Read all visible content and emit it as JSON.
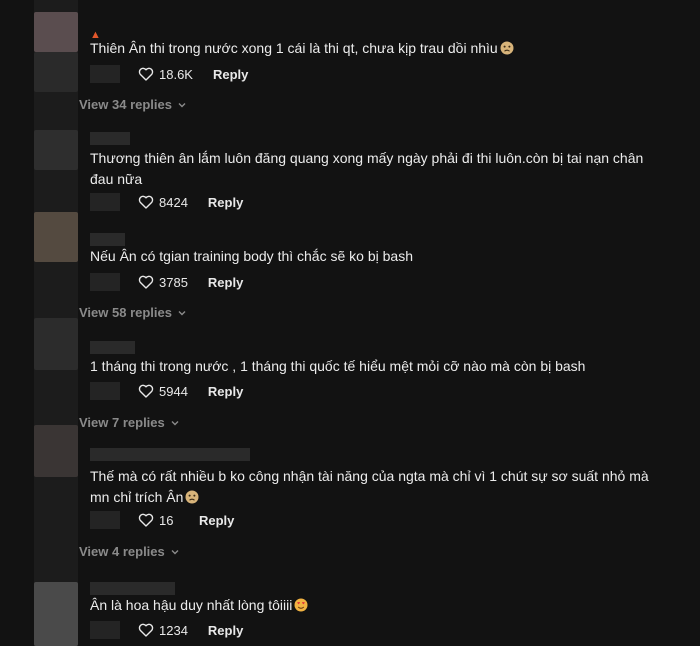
{
  "comments": [
    {
      "text": "Thiên Ân thi trong nước xong 1 cái là thi qt, chưa kịp trau dồi nhìu",
      "emoji_icon": "sad-face-icon",
      "likes": "18.6K",
      "reply_label": "Reply",
      "view_replies": "View 34 replies"
    },
    {
      "text": "Thương thiên ân lắm luôn đăng quang xong mấy ngày phải đi thi luôn.còn bị tai nạn chân đau nữa",
      "likes": "8424",
      "reply_label": "Reply"
    },
    {
      "text": "Nếu Ân có tgian training body thì chắc sẽ ko bị bash",
      "likes": "3785",
      "reply_label": "Reply",
      "view_replies": "View 58 replies"
    },
    {
      "text": "1 tháng thi trong nước , 1 tháng thi quốc tế hiểu mệt mỏi cỡ nào mà còn bị bash",
      "likes": "5944",
      "reply_label": "Reply",
      "view_replies": "View 7 replies"
    },
    {
      "text": "Thế mà có rất nhiều b ko công nhận tài năng của ngta mà chỉ vì 1 chút sự sơ suất nhỏ mà mn chỉ trích Ân",
      "emoji_icon": "sad-face-icon",
      "likes": "16",
      "reply_label": "Reply",
      "view_replies": "View 4 replies"
    },
    {
      "text": "Ân là hoa hậu duy nhất lòng tôiiii",
      "emoji_icon": "heart-eyes-face-icon",
      "likes": "1234",
      "reply_label": "Reply"
    }
  ],
  "colors": {
    "background": "#121212",
    "text": "#ececec",
    "muted": "#8a8a8a",
    "badge": "#e2572b"
  }
}
